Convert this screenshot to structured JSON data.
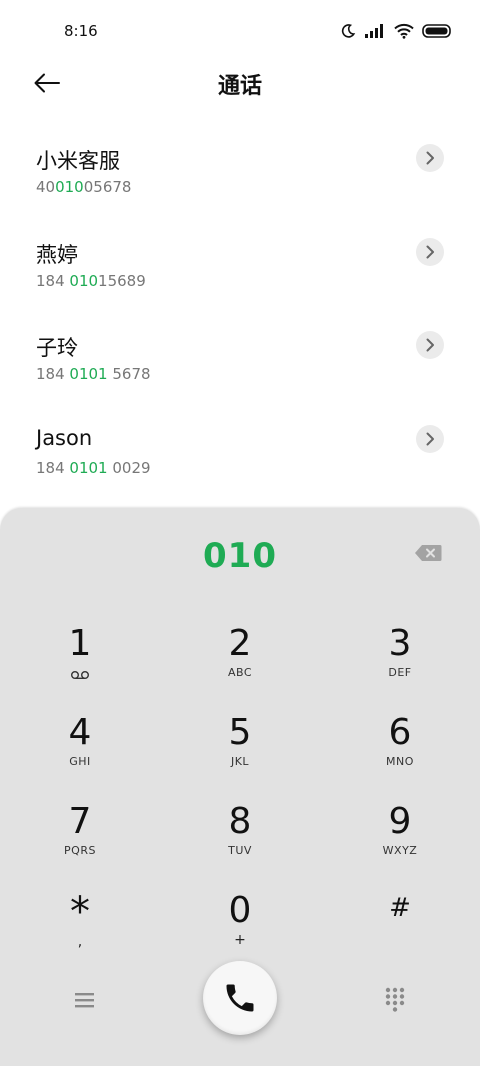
{
  "status_bar": {
    "time": "8:16",
    "icons": [
      "moon-icon",
      "signal-icon",
      "wifi-icon",
      "battery-icon"
    ]
  },
  "header": {
    "title": "通话",
    "back_icon": "arrow-left-icon"
  },
  "contacts": [
    {
      "name": "小米客服",
      "number_parts": [
        "40",
        "010",
        "05678"
      ]
    },
    {
      "name": "燕婷",
      "number_parts": [
        "184 ",
        "010",
        "15689"
      ]
    },
    {
      "name": "子玲",
      "number_parts": [
        "184 ",
        "0101",
        " 5678"
      ]
    },
    {
      "name": "Jason",
      "number_parts": [
        "184 ",
        "0101",
        " 0029"
      ]
    }
  ],
  "dialpad": {
    "number": "010",
    "keys": [
      {
        "digit": "1",
        "letters": "",
        "sub_icon": "voicemail-icon"
      },
      {
        "digit": "2",
        "letters": "ABC"
      },
      {
        "digit": "3",
        "letters": "DEF"
      },
      {
        "digit": "4",
        "letters": "GHI"
      },
      {
        "digit": "5",
        "letters": "JKL"
      },
      {
        "digit": "6",
        "letters": "MNO"
      },
      {
        "digit": "7",
        "letters": "PQRS"
      },
      {
        "digit": "8",
        "letters": "TUV"
      },
      {
        "digit": "9",
        "letters": "WXYZ"
      },
      {
        "digit": "*",
        "letters": ","
      },
      {
        "digit": "0",
        "letters": "+"
      },
      {
        "digit": "#",
        "letters": ""
      }
    ],
    "bottom_icons": [
      "menu-icon",
      "phone-icon",
      "dialpad-icon"
    ]
  },
  "colors": {
    "accent_green": "#1fab54",
    "dialpad_bg": "#e2e2e2"
  }
}
